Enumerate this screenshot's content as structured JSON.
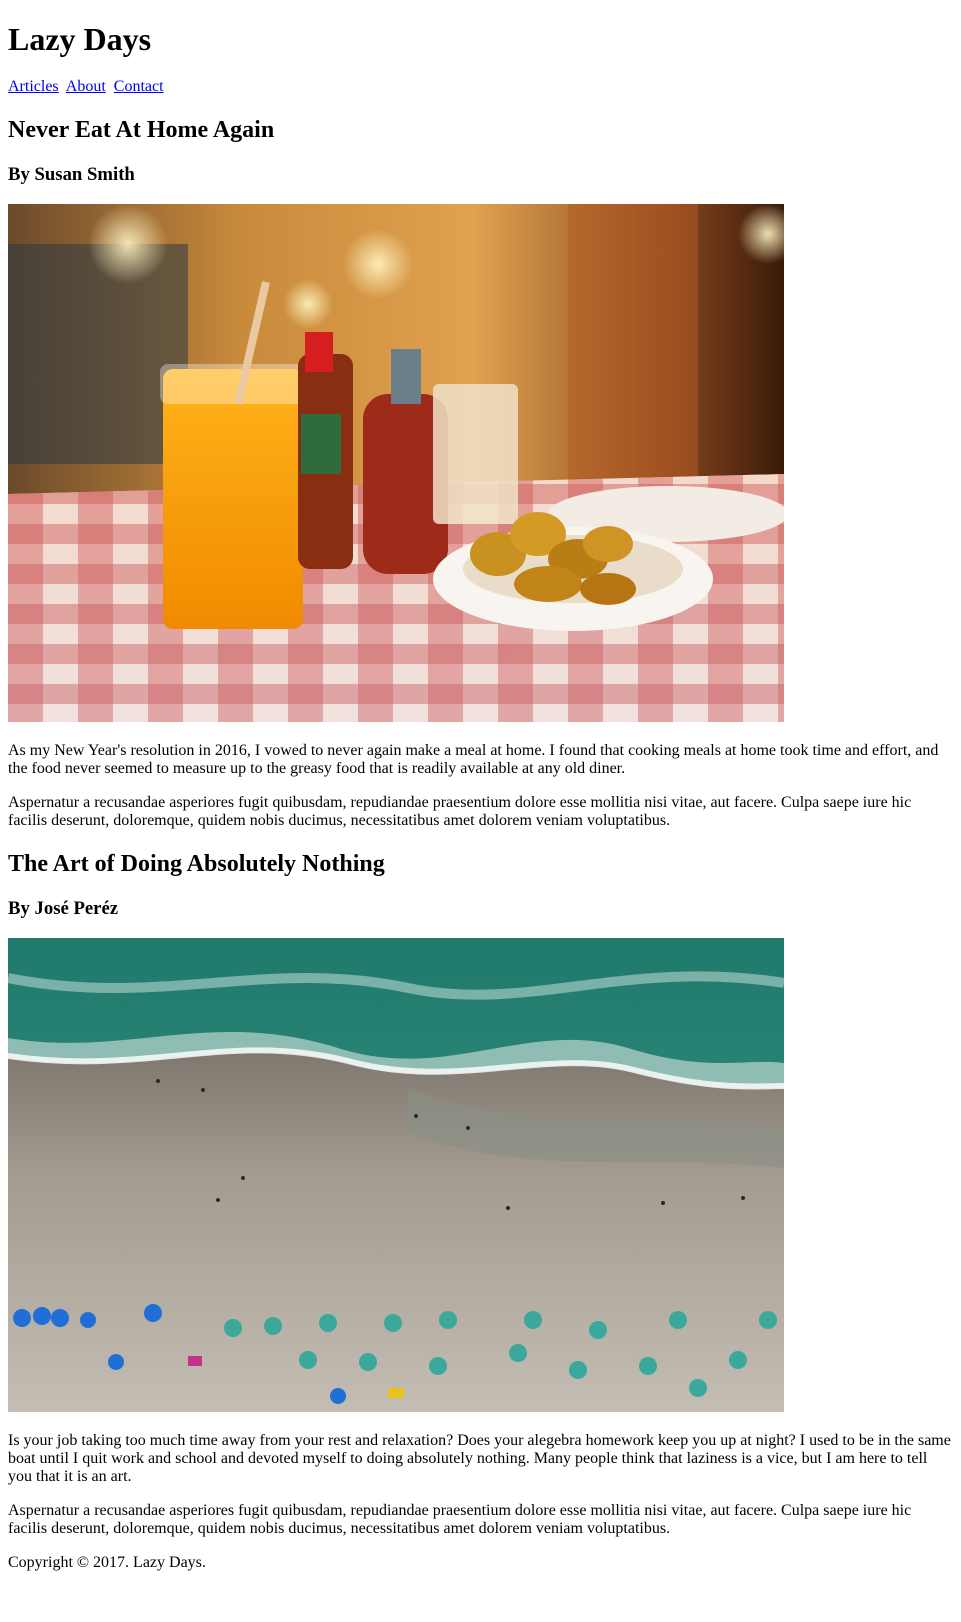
{
  "site": {
    "title": "Lazy Days"
  },
  "nav": {
    "items": [
      "Articles",
      "About",
      "Contact"
    ]
  },
  "articles": [
    {
      "title": "Never Eat At Home Again",
      "byline": "By Susan Smith",
      "image": "diner-table-photo",
      "paragraphs": [
        "As my New Year's resolution in 2016, I vowed to never again make a meal at home. I found that cooking meals at home took time and effort, and the food never seemed to measure up to the greasy food that is readily available at any old diner.",
        "Aspernatur a recusandae asperiores fugit quibusdam, repudiandae praesentium dolore esse mollitia nisi vitae, aut facere. Culpa saepe iure hic facilis deserunt, doloremque, quidem nobis ducimus, necessitatibus amet dolorem veniam voluptatibus."
      ]
    },
    {
      "title": "The Art of Doing Absolutely Nothing",
      "byline": "By José Peréz",
      "image": "aerial-beach-photo",
      "paragraphs": [
        "Is your job taking too much time away from your rest and relaxation? Does your alegebra homework keep you up at night? I used to be in the same boat until I quit work and school and devoted myself to doing absolutely nothing. Many people think that laziness is a vice, but I am here to tell you that it is an art.",
        "Aspernatur a recusandae asperiores fugit quibusdam, repudiandae praesentium dolore esse mollitia nisi vitae, aut facere. Culpa saepe iure hic facilis deserunt, doloremque, quidem nobis ducimus, necessitatibus amet dolorem veniam voluptatibus."
      ]
    }
  ],
  "footer": {
    "copyright": "Copyright © 2017. Lazy Days."
  }
}
